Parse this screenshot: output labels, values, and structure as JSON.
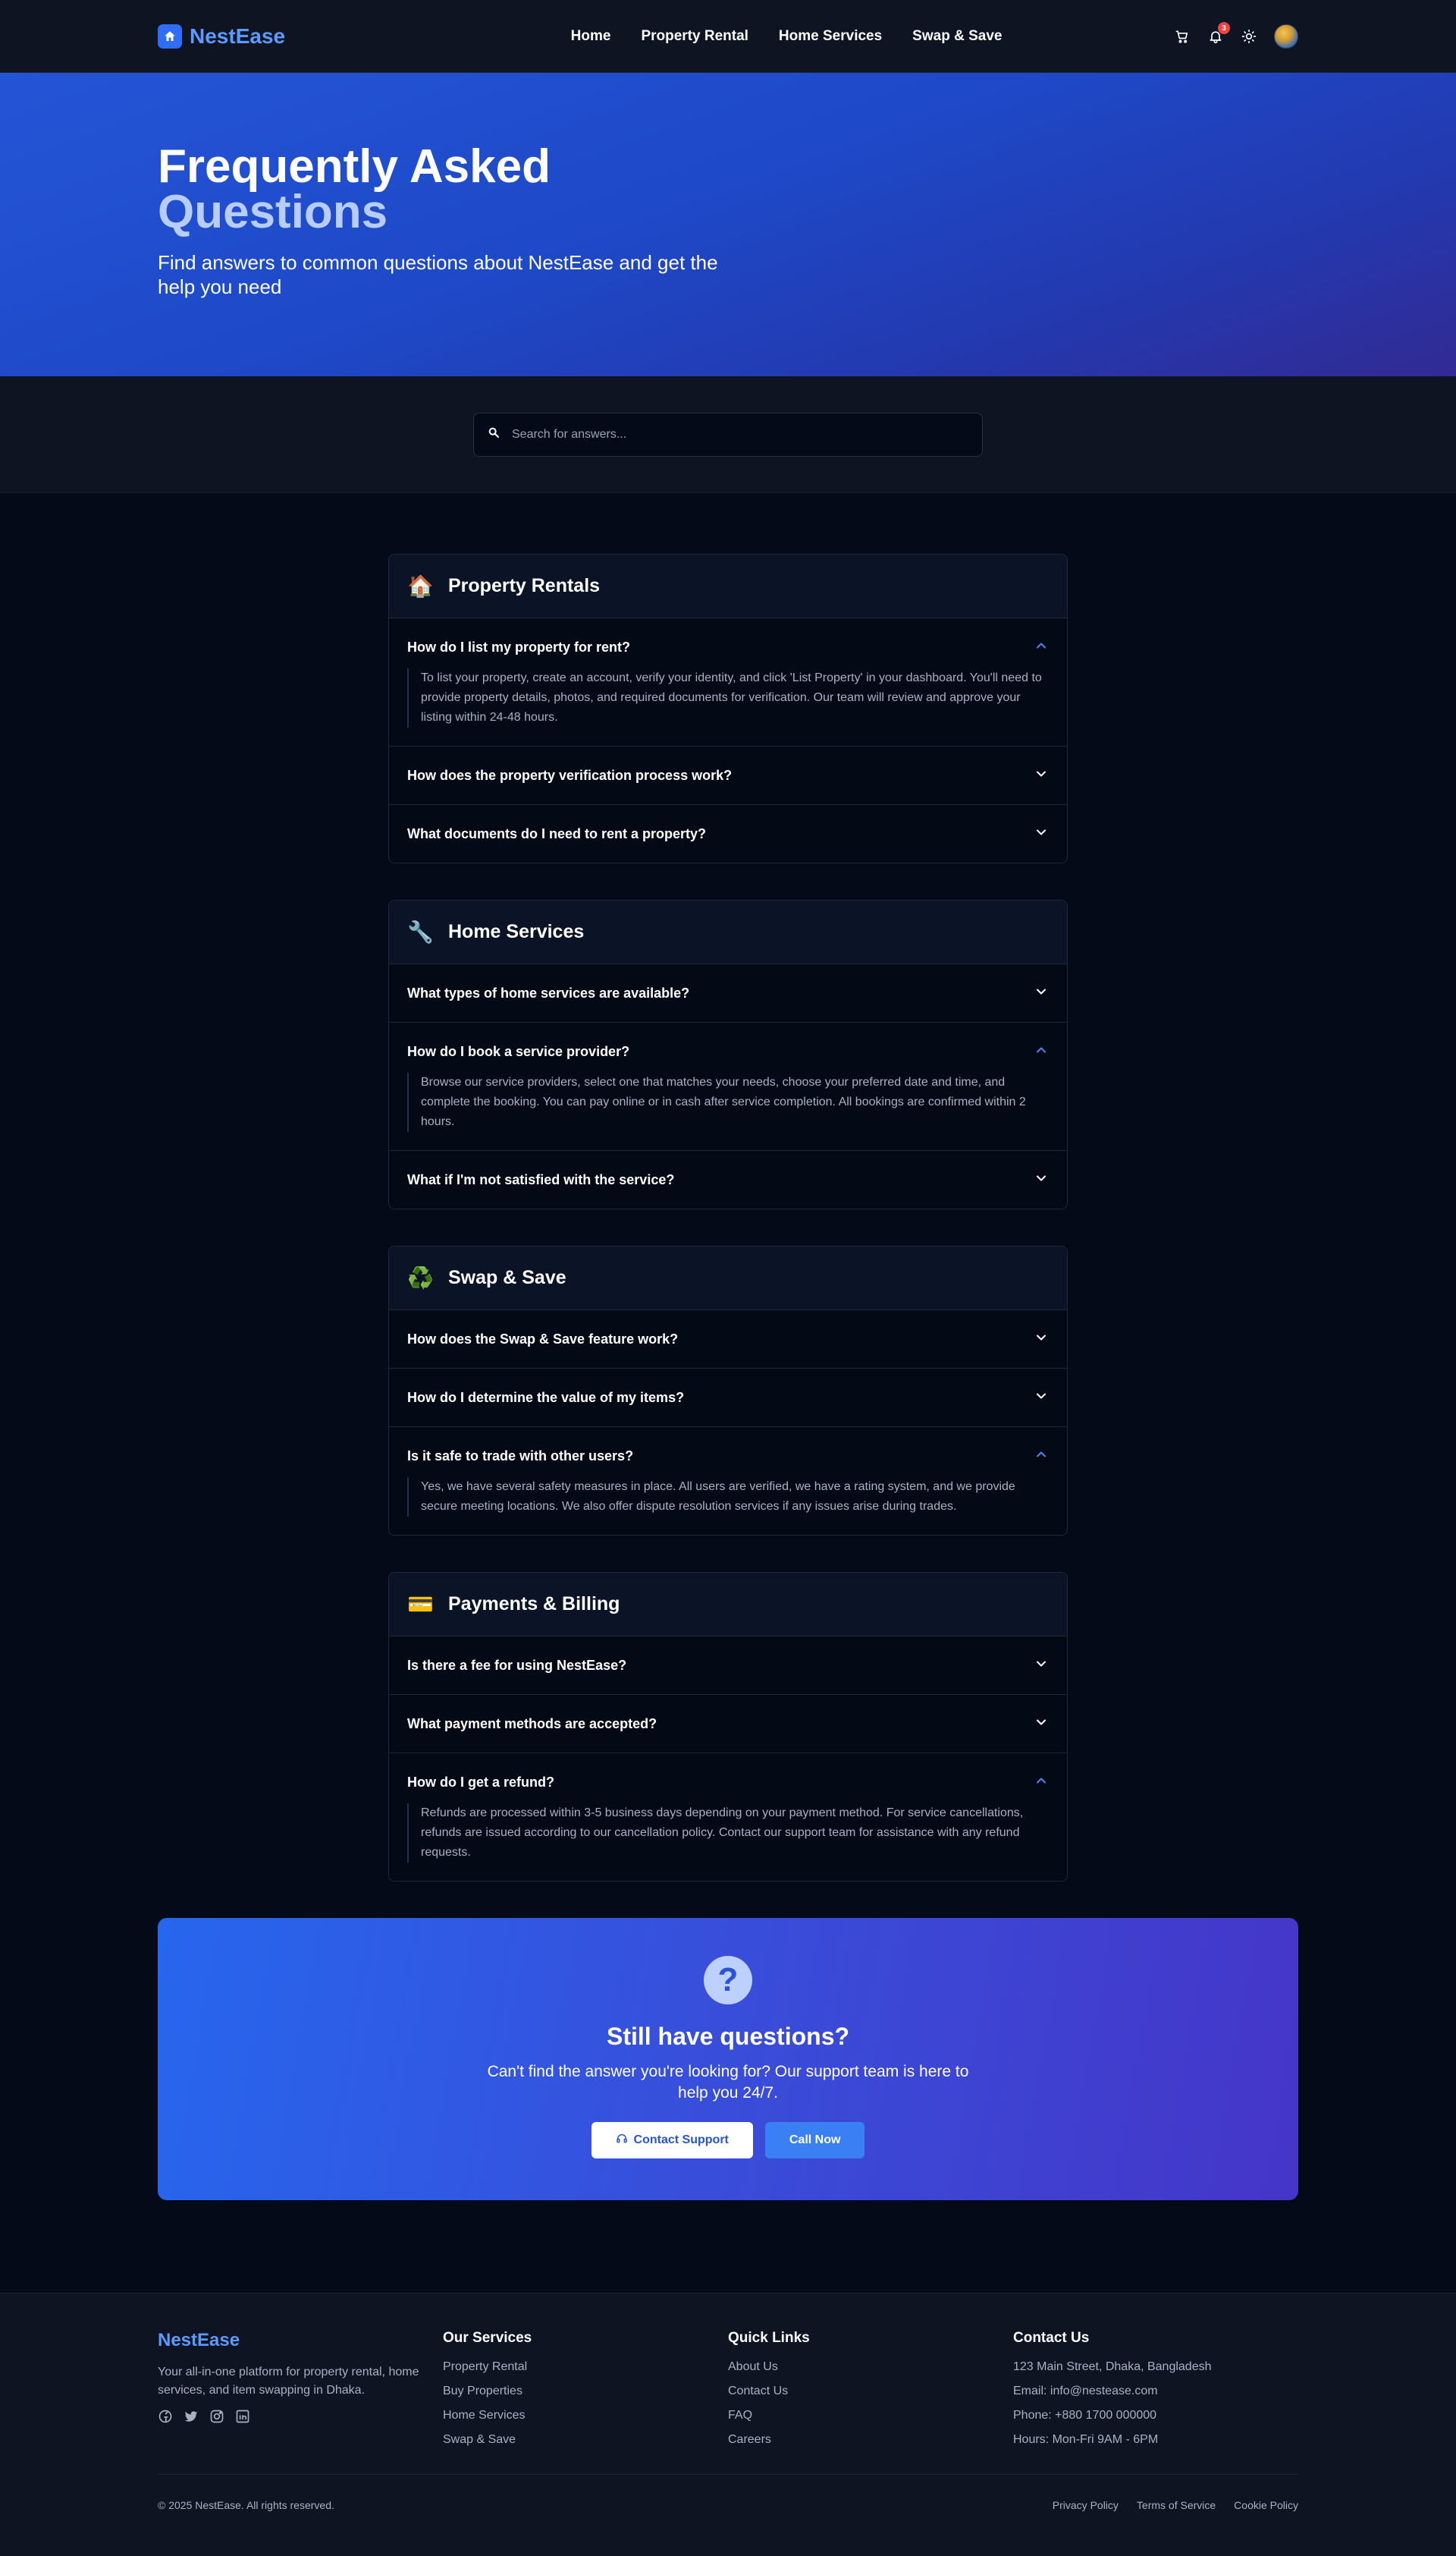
{
  "nav": {
    "brand": "NestEase",
    "links": [
      "Home",
      "Property Rental",
      "Home Services",
      "Swap & Save"
    ],
    "notification_count": "3",
    "icons": [
      "cart-icon",
      "bell-icon",
      "sun-icon",
      "avatar"
    ]
  },
  "hero": {
    "title_line1": "Frequently Asked",
    "title_line2": "Questions",
    "subtitle": "Find answers to common questions about NestEase and get the help you need"
  },
  "search": {
    "placeholder": "Search for answers..."
  },
  "categories": [
    {
      "emoji": "🏠",
      "title": "Property Rentals",
      "items": [
        {
          "q": "How do I list my property for rent?",
          "open": true,
          "a": "To list your property, create an account, verify your identity, and click 'List Property' in your dashboard. You'll need to provide property details, photos, and required documents for verification. Our team will review and approve your listing within 24-48 hours."
        },
        {
          "q": "How does the property verification process work?",
          "open": false
        },
        {
          "q": "What documents do I need to rent a property?",
          "open": false
        }
      ]
    },
    {
      "emoji": "🔧",
      "title": "Home Services",
      "items": [
        {
          "q": "What types of home services are available?",
          "open": false
        },
        {
          "q": "How do I book a service provider?",
          "open": true,
          "a": "Browse our service providers, select one that matches your needs, choose your preferred date and time, and complete the booking. You can pay online or in cash after service completion. All bookings are confirmed within 2 hours."
        },
        {
          "q": "What if I'm not satisfied with the service?",
          "open": false
        }
      ]
    },
    {
      "emoji": "♻️",
      "title": "Swap & Save",
      "items": [
        {
          "q": "How does the Swap & Save feature work?",
          "open": false
        },
        {
          "q": "How do I determine the value of my items?",
          "open": false
        },
        {
          "q": "Is it safe to trade with other users?",
          "open": true,
          "a": "Yes, we have several safety measures in place. All users are verified, we have a rating system, and we provide secure meeting locations. We also offer dispute resolution services if any issues arise during trades."
        }
      ]
    },
    {
      "emoji": "💳",
      "title": "Payments & Billing",
      "items": [
        {
          "q": "Is there a fee for using NestEase?",
          "open": false
        },
        {
          "q": "What payment methods are accepted?",
          "open": false
        },
        {
          "q": "How do I get a refund?",
          "open": true,
          "a": "Refunds are processed within 3-5 business days depending on your payment method. For service cancellations, refunds are issued according to our cancellation policy. Contact our support team for assistance with any refund requests."
        }
      ]
    }
  ],
  "cta": {
    "icon": "?",
    "title": "Still have questions?",
    "subtitle": "Can't find the answer you're looking for? Our support team is here to help you 24/7.",
    "contact_label": "Contact Support",
    "call_label": "Call Now"
  },
  "footer": {
    "brand": "NestEase",
    "description": "Your all-in-one platform for property rental, home services, and item swapping in Dhaka.",
    "services_title": "Our Services",
    "services": [
      "Property Rental",
      "Buy Properties",
      "Home Services",
      "Swap & Save"
    ],
    "quick_title": "Quick Links",
    "quick_links": [
      "About Us",
      "Contact Us",
      "FAQ",
      "Careers"
    ],
    "contact_title": "Contact Us",
    "contact": [
      "123 Main Street, Dhaka, Bangladesh",
      "Email: info@nestease.com",
      "Phone: +880 1700 000000",
      "Hours: Mon-Fri 9AM - 6PM"
    ],
    "copyright": "© 2025 NestEase. All rights reserved.",
    "legal": [
      "Privacy Policy",
      "Terms of Service",
      "Cookie Policy"
    ]
  },
  "colors": {
    "accent": "#2f6df6",
    "brand_text": "#5b9bff",
    "page_bg": "#050a18",
    "panel_bg": "#0f1422"
  }
}
